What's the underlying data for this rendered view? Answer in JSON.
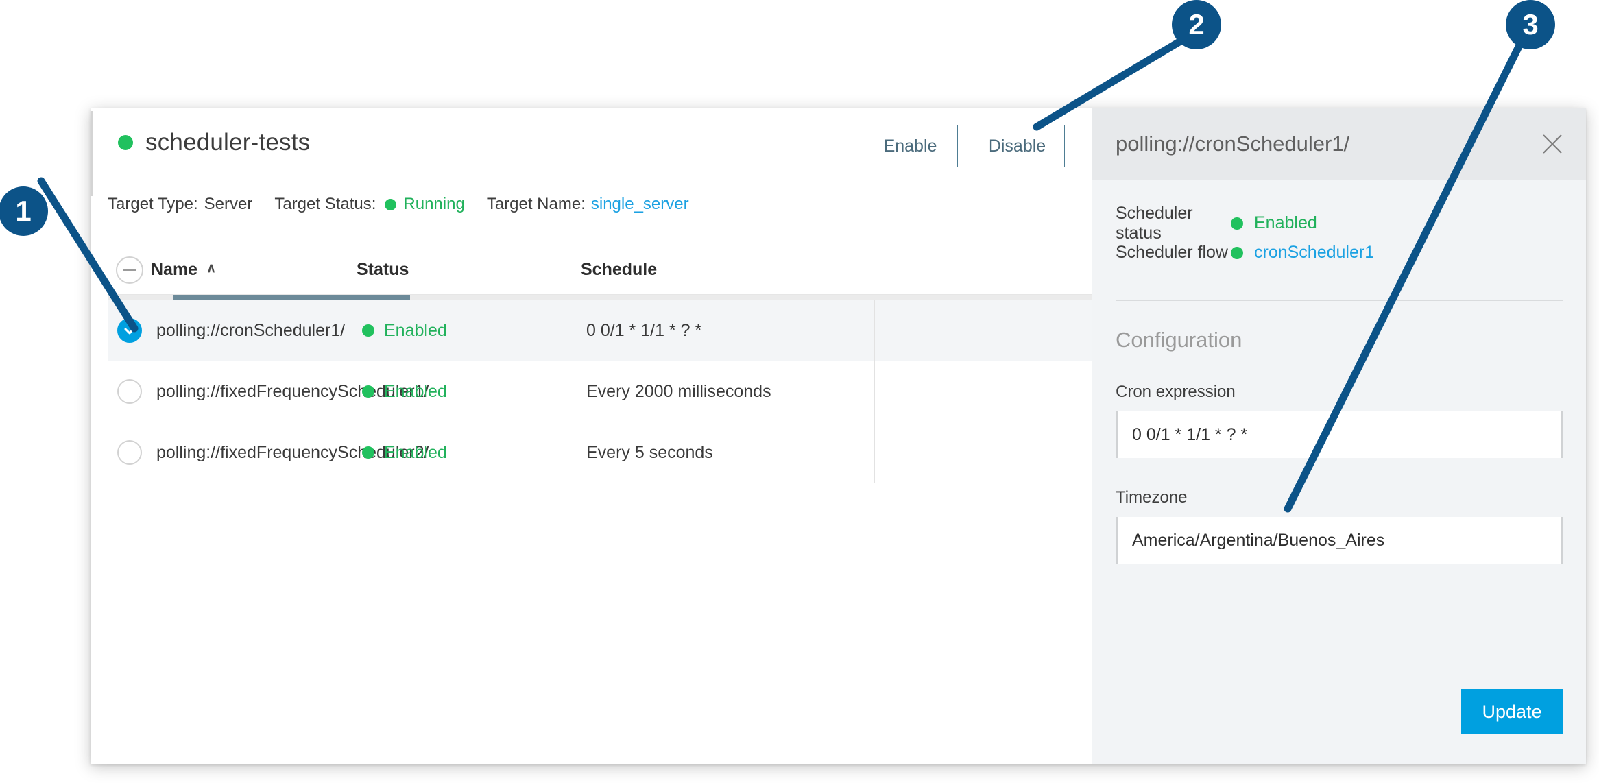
{
  "dialog": {
    "title": "scheduler-tests",
    "status_dot_color": "#21c15e",
    "meta": {
      "target_type_label": "Target Type:",
      "target_type_value": "Server",
      "target_status_label": "Target Status:",
      "target_status_value": "Running",
      "target_name_label": "Target Name:",
      "target_name_value": "single_server"
    },
    "actions": {
      "enable_label": "Enable",
      "disable_label": "Disable"
    }
  },
  "table": {
    "columns": {
      "name": "Name",
      "status": "Status",
      "schedule": "Schedule"
    },
    "sort_indicator": "∧",
    "rows": [
      {
        "selected": true,
        "name": "polling://cronScheduler1/",
        "status": "Enabled",
        "schedule": "0 0/1 * 1/1 * ? *"
      },
      {
        "selected": false,
        "name": "polling://fixedFrequencyScheduler1/",
        "status": "Enabled",
        "schedule": "Every 2000 milliseconds"
      },
      {
        "selected": false,
        "name": "polling://fixedFrequencyScheduler2/",
        "status": "Enabled",
        "schedule": "Every 5 seconds"
      }
    ]
  },
  "panel": {
    "title": "polling://cronScheduler1/",
    "scheduler_status_label": "Scheduler status",
    "scheduler_status_value": "Enabled",
    "scheduler_flow_label": "Scheduler flow",
    "scheduler_flow_value": "cronScheduler1",
    "section_title": "Configuration",
    "cron_label": "Cron expression",
    "cron_value": "0 0/1 * 1/1 * ? *",
    "timezone_label": "Timezone",
    "timezone_value": "America/Argentina/Buenos_Aires",
    "update_label": "Update"
  },
  "callouts": [
    {
      "number": "1"
    },
    {
      "number": "2"
    },
    {
      "number": "3"
    }
  ],
  "colors": {
    "accent_blue": "#00a0e0",
    "callout_blue": "#0c5388",
    "status_green": "#21b15b",
    "link_blue": "#1ba1e2"
  }
}
